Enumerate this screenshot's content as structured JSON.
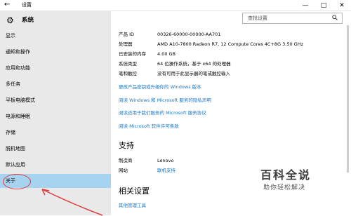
{
  "window": {
    "title": "设置",
    "back_icon": "←",
    "min": "—",
    "max": "□",
    "close": "✕"
  },
  "sidebar": {
    "title": "系统",
    "items": [
      {
        "label": "显示"
      },
      {
        "label": "通知和操作"
      },
      {
        "label": "应用和功能"
      },
      {
        "label": "多任务"
      },
      {
        "label": "平板电脑模式"
      },
      {
        "label": "电源和睡眠"
      },
      {
        "label": "存储"
      },
      {
        "label": "脱机地图"
      },
      {
        "label": "默认应用"
      },
      {
        "label": "关于",
        "active": true
      }
    ]
  },
  "search": {
    "placeholder": "查找设置"
  },
  "info": {
    "rows": [
      {
        "label": "产品 ID",
        "value": "00326-60000-00000-AA701"
      },
      {
        "label": "处理器",
        "value": "AMD A10-7800 Radeon R7, 12 Compute Cores 4C+8G   3.50 GHz"
      },
      {
        "label": "已安装的内存",
        "value": "4.00 GB"
      },
      {
        "label": "系统类型",
        "value": "64 位操作系统，基于 x64 的处理器"
      },
      {
        "label": "笔和触控",
        "value": "没有可用于此显示器的笔或触控输入"
      }
    ],
    "links": [
      "更改产品密钥或升级你的 Windows 版本",
      "阅读 Windows 和 Microsoft 服务的隐私声明",
      "阅读适用于我们服务的 Microsoft 服务协议",
      "阅读 Microsoft 软件许可条款"
    ]
  },
  "support": {
    "heading": "支持",
    "rows": [
      {
        "label": "制造商",
        "value": "Lenovo",
        "is_link": false
      },
      {
        "label": "网站",
        "value": "联机支持",
        "is_link": true
      }
    ]
  },
  "related": {
    "heading": "相关设置",
    "link": "其他管理工具"
  },
  "watermark": {
    "main": "百科全说",
    "sub": "助你轻松解决"
  },
  "colors": {
    "active_item": "#a6d4f0",
    "link": "#1a76c9",
    "annotation": "#e23838"
  }
}
